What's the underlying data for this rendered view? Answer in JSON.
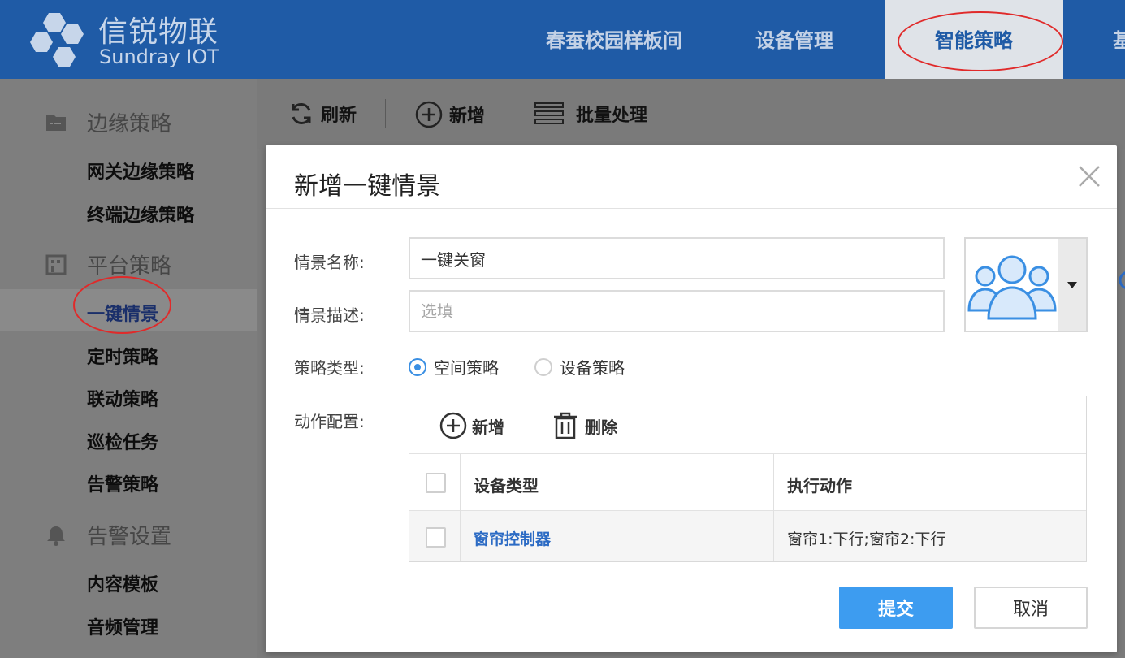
{
  "header": {
    "brand_cn": "信锐物联",
    "brand_en": "Sundray IOT",
    "nav": [
      {
        "label": "春蚕校园样板间"
      },
      {
        "label": "设备管理"
      },
      {
        "label": "智能策略"
      },
      {
        "label": "基"
      }
    ]
  },
  "sidebar": {
    "groups": [
      {
        "label": "边缘策略",
        "icon": "folder-icon"
      },
      {
        "label": "平台策略",
        "icon": "building-icon"
      },
      {
        "label": "告警设置",
        "icon": "bell-icon"
      }
    ],
    "items": [
      {
        "label": "网关边缘策略"
      },
      {
        "label": "终端边缘策略"
      },
      {
        "label": "一键情景"
      },
      {
        "label": "定时策略"
      },
      {
        "label": "联动策略"
      },
      {
        "label": "巡检任务"
      },
      {
        "label": "告警策略"
      },
      {
        "label": "内容模板"
      },
      {
        "label": "音频管理"
      }
    ],
    "active_item": "一键情景"
  },
  "toolbar": {
    "refresh_label": "刷新",
    "add_label": "新增",
    "batch_label": "批量处理"
  },
  "modal": {
    "title": "新增一键情景",
    "name_label": "情景名称:",
    "name_value": "一键关窗",
    "desc_label": "情景描述:",
    "desc_placeholder": "选填",
    "type_label": "策略类型:",
    "type_options": [
      {
        "label": "空间策略",
        "selected": true
      },
      {
        "label": "设备策略",
        "selected": false
      }
    ],
    "action_label": "动作配置:",
    "action_add_label": "新增",
    "action_delete_label": "删除",
    "table": {
      "headers": [
        "设备类型",
        "执行动作"
      ],
      "rows": [
        {
          "device_type": "窗帘控制器",
          "action": "窗帘1:下行;窗帘2:下行"
        }
      ]
    },
    "submit_label": "提交",
    "cancel_label": "取消"
  },
  "colors": {
    "header_bg": "#1f5ba6",
    "accent": "#3d9cf0",
    "link": "#2c6bc4",
    "annotation": "#e02a2a"
  }
}
